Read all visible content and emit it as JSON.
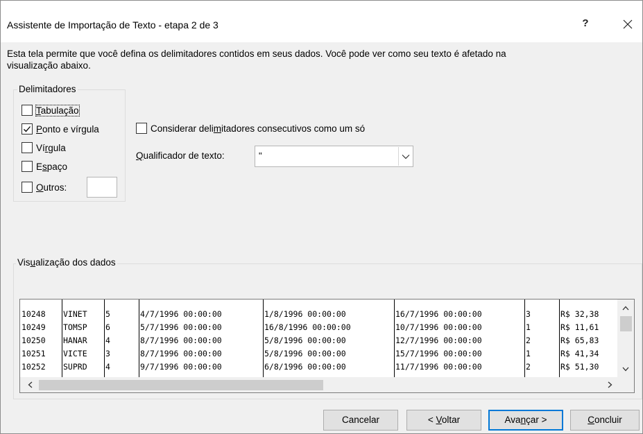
{
  "window": {
    "title": "Assistente de Importação de Texto - etapa 2 de 3",
    "help_label": "?"
  },
  "description": {
    "line1": "Esta tela permite que você defina os delimitadores contidos em seus dados. Você pode ver como seu texto é afetado na",
    "line2": "visualização abaixo."
  },
  "delimiters": {
    "group_label": "Delimitadores",
    "items": [
      {
        "before": "",
        "accel": "T",
        "after": "abulação",
        "checked": false
      },
      {
        "before": "",
        "accel": "P",
        "after": "onto e vírgula",
        "checked": true
      },
      {
        "before": "Ví",
        "accel": "r",
        "after": "gula",
        "checked": false
      },
      {
        "before": "E",
        "accel": "s",
        "after": "paço",
        "checked": false
      },
      {
        "before": "",
        "accel": "O",
        "after": "utros:",
        "checked": false
      }
    ],
    "other_value": ""
  },
  "options": {
    "consecutive": {
      "before": "Considerar deli",
      "accel": "m",
      "after": "itadores consecutivos como um só",
      "checked": false
    },
    "qualifier": {
      "before": "",
      "accel": "Q",
      "after": "ualificador de texto:",
      "value": "\""
    }
  },
  "preview": {
    "group_label_before": "Vis",
    "group_label_accel": "u",
    "group_label_after": "alização dos dados",
    "rows": [
      [
        "10248",
        "VINET",
        "5",
        "4/7/1996 00:00:00",
        "1/8/1996 00:00:00",
        "16/7/1996 00:00:00",
        "3",
        "R$ 32,38"
      ],
      [
        "10249",
        "TOMSP",
        "6",
        "5/7/1996 00:00:00",
        "16/8/1996 00:00:00",
        "10/7/1996 00:00:00",
        "1",
        "R$ 11,61"
      ],
      [
        "10250",
        "HANAR",
        "4",
        "8/7/1996 00:00:00",
        "5/8/1996 00:00:00",
        "12/7/1996 00:00:00",
        "2",
        "R$ 65,83"
      ],
      [
        "10251",
        "VICTE",
        "3",
        "8/7/1996 00:00:00",
        "5/8/1996 00:00:00",
        "15/7/1996 00:00:00",
        "1",
        "R$ 41,34"
      ],
      [
        "10252",
        "SUPRD",
        "4",
        "9/7/1996 00:00:00",
        "6/8/1996 00:00:00",
        "11/7/1996 00:00:00",
        "2",
        "R$ 51,30"
      ]
    ]
  },
  "buttons": {
    "cancel": {
      "before": "Cancelar",
      "accel": "",
      "after": ""
    },
    "back": {
      "before": "< ",
      "accel": "V",
      "after": "oltar"
    },
    "next": {
      "before": "Ava",
      "accel": "n",
      "after": "çar >"
    },
    "finish": {
      "before": "",
      "accel": "C",
      "after": "oncluir"
    }
  },
  "colors": {
    "accent": "#0078d7",
    "dialog_bg": "#f0f0f0"
  }
}
